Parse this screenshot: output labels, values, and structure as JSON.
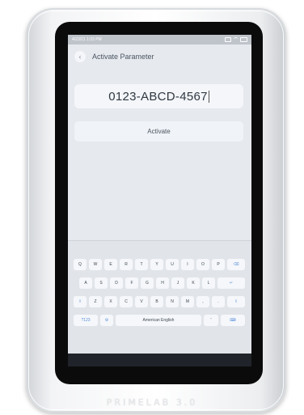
{
  "device": {
    "brand": "PRIMELAB 3.0"
  },
  "statusbar": {
    "datetime": "4/23/21 1:03 PM",
    "icons": [
      "signal-icon",
      "wifi-icon",
      "battery-icon"
    ]
  },
  "header": {
    "back_icon": "back-arrow-icon",
    "back_glyph": "‹",
    "title": "Activate Parameter"
  },
  "code_input": {
    "value": "0123-ABCD-4567"
  },
  "activate_button": {
    "label": "Activate"
  },
  "keyboard": {
    "row1": [
      "Q",
      "W",
      "E",
      "R",
      "T",
      "Y",
      "U",
      "I",
      "O",
      "P",
      "⌫"
    ],
    "row2": [
      "A",
      "S",
      "D",
      "F",
      "G",
      "H",
      "J",
      "K",
      "L",
      "↵"
    ],
    "row3": [
      "⇧",
      "Z",
      "X",
      "C",
      "V",
      "B",
      "N",
      "M",
      ",",
      ".",
      "⇧"
    ],
    "row4": [
      "?123",
      "⚙",
      "American English",
      "'",
      "⌨"
    ]
  },
  "colors": {
    "screen_bg": "#e6e9ee",
    "accent": "#5b8fd8",
    "bezel": "#0b0b0c"
  }
}
